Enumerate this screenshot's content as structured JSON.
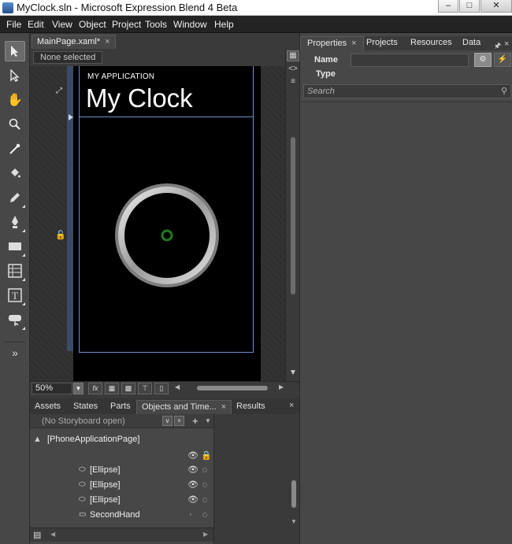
{
  "window": {
    "title": "MyClock.sln - Microsoft Expression Blend 4 Beta"
  },
  "menu": {
    "items": [
      "File",
      "Edit",
      "View",
      "Object",
      "Project",
      "Tools",
      "Window",
      "Help"
    ]
  },
  "document": {
    "tab_label": "MainPage.xaml*",
    "selection_text": "None selected",
    "zoom": "50%"
  },
  "phone": {
    "app_title": "MY APPLICATION",
    "page_title": "My Clock"
  },
  "bottom_tabs": [
    "Assets",
    "States",
    "Parts",
    "Objects and Time...",
    "Results"
  ],
  "objects": {
    "storyboard_text": "(No Storyboard open)",
    "root": "[PhoneApplicationPage]",
    "rows": [
      {
        "label": "[Ellipse]",
        "icon": "ellipse-icon",
        "visible": true
      },
      {
        "label": "[Ellipse]",
        "icon": "ellipse-icon",
        "visible": true
      },
      {
        "label": "[Ellipse]",
        "icon": "ellipse-icon",
        "visible": true
      },
      {
        "label": "SecondHand",
        "icon": "rectangle-icon",
        "visible": false
      }
    ]
  },
  "properties": {
    "tabs": [
      "Properties",
      "Projects",
      "Resources",
      "Data"
    ],
    "name_label": "Name",
    "name_value": "",
    "type_label": "Type",
    "search_placeholder": "Search"
  },
  "colors": {
    "accent_selection": "#6f8fd0",
    "clock_center": "#1f7a1f"
  }
}
